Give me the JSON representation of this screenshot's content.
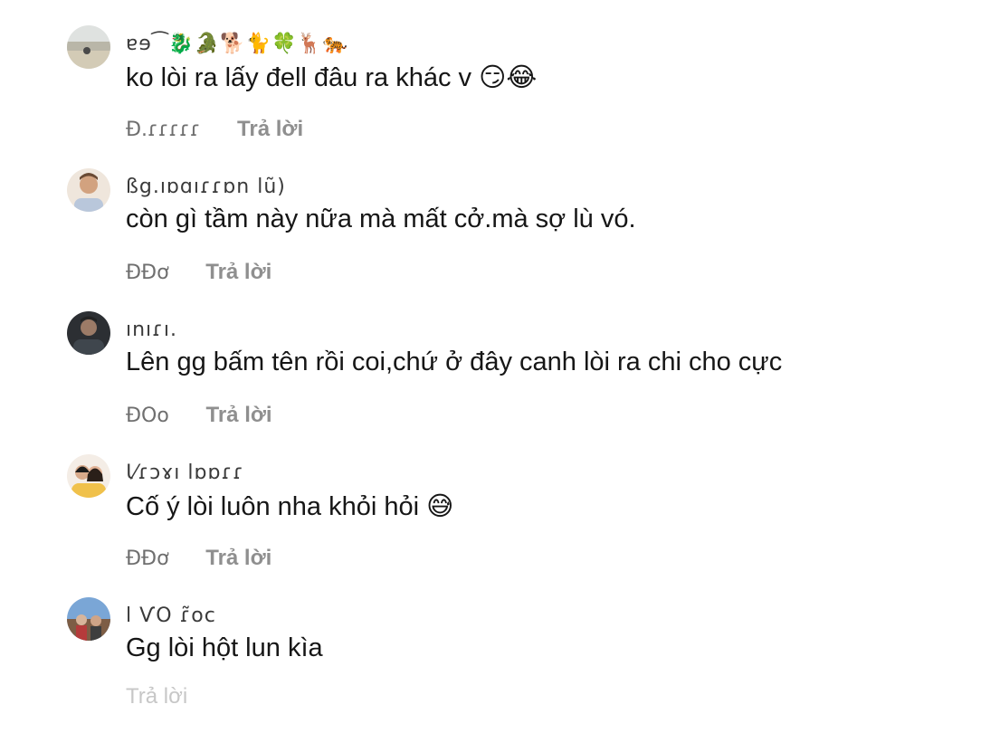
{
  "comments": [
    {
      "username": "ɐɘ⁀🐉🐊🐕🐈🍀🦌🐅",
      "text": "ko lòi ra lấy đell đâu ra khác v 😏😂",
      "time": "Đ.ɾɾɾɾɾ",
      "reply": "Trả lời"
    },
    {
      "username": "ßg.ıɒɑıɾɾɒn lũ)",
      "text": "còn gì tầm này nữa mà mất cở.mà sợ lù vó.",
      "time": "ĐĐơ",
      "reply": "Trả lời"
    },
    {
      "username": "ınıɾı.",
      "text": "Lên gg bấm tên rồi coi,chứ ở đây canh lòi ra chi cho cực",
      "time": "ĐOo",
      "reply": "Trả lời"
    },
    {
      "username": "Ɩ⁄ɾɔɤı lɒɒɾɾ",
      "text": "Cố ý lòi luôn nha khỏi hỏi 😅",
      "time": "ĐĐơ",
      "reply": "Trả lời"
    },
    {
      "username": "l ѴO ɾ̃oc",
      "text": "Gg lòi hột lun kìa",
      "time": "",
      "reply": ""
    }
  ],
  "faded_footer": "Trả lời",
  "colors": {
    "background": "#ffffff",
    "text": "#161616",
    "meta": "#8a8a8a"
  }
}
